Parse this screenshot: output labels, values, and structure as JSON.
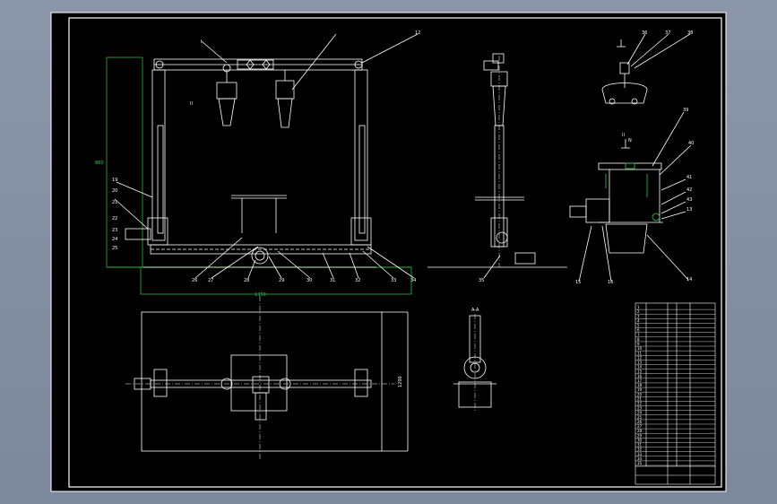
{
  "drawing": {
    "front_view_labels": [
      "I",
      "II",
      "12",
      "19",
      "20",
      "21",
      "22",
      "23",
      "24",
      "25",
      "26",
      "27",
      "28",
      "29",
      "30",
      "31",
      "32",
      "33",
      "34",
      "35",
      "36"
    ],
    "side_view_labels": [
      "13",
      "14",
      "15",
      "16",
      "17",
      "18",
      "37",
      "38",
      "39",
      "40",
      "41",
      "42",
      "43"
    ],
    "section_mark": "II",
    "section_mark_sub": "N",
    "plan_dim_label": "1200",
    "dim_front_width": "1350",
    "dim_front_height": "880",
    "detail_label": "A-A"
  },
  "title_block": {
    "rows": [
      "1",
      "2",
      "3",
      "4",
      "5",
      "6",
      "7",
      "8",
      "9",
      "10",
      "11",
      "12",
      "13",
      "14",
      "15",
      "16",
      "17",
      "18",
      "19",
      "20",
      "21",
      "22",
      "23",
      "24",
      "25",
      "26",
      "27",
      "28",
      "29",
      "30",
      "31",
      "32",
      "33",
      "34",
      "35"
    ]
  }
}
